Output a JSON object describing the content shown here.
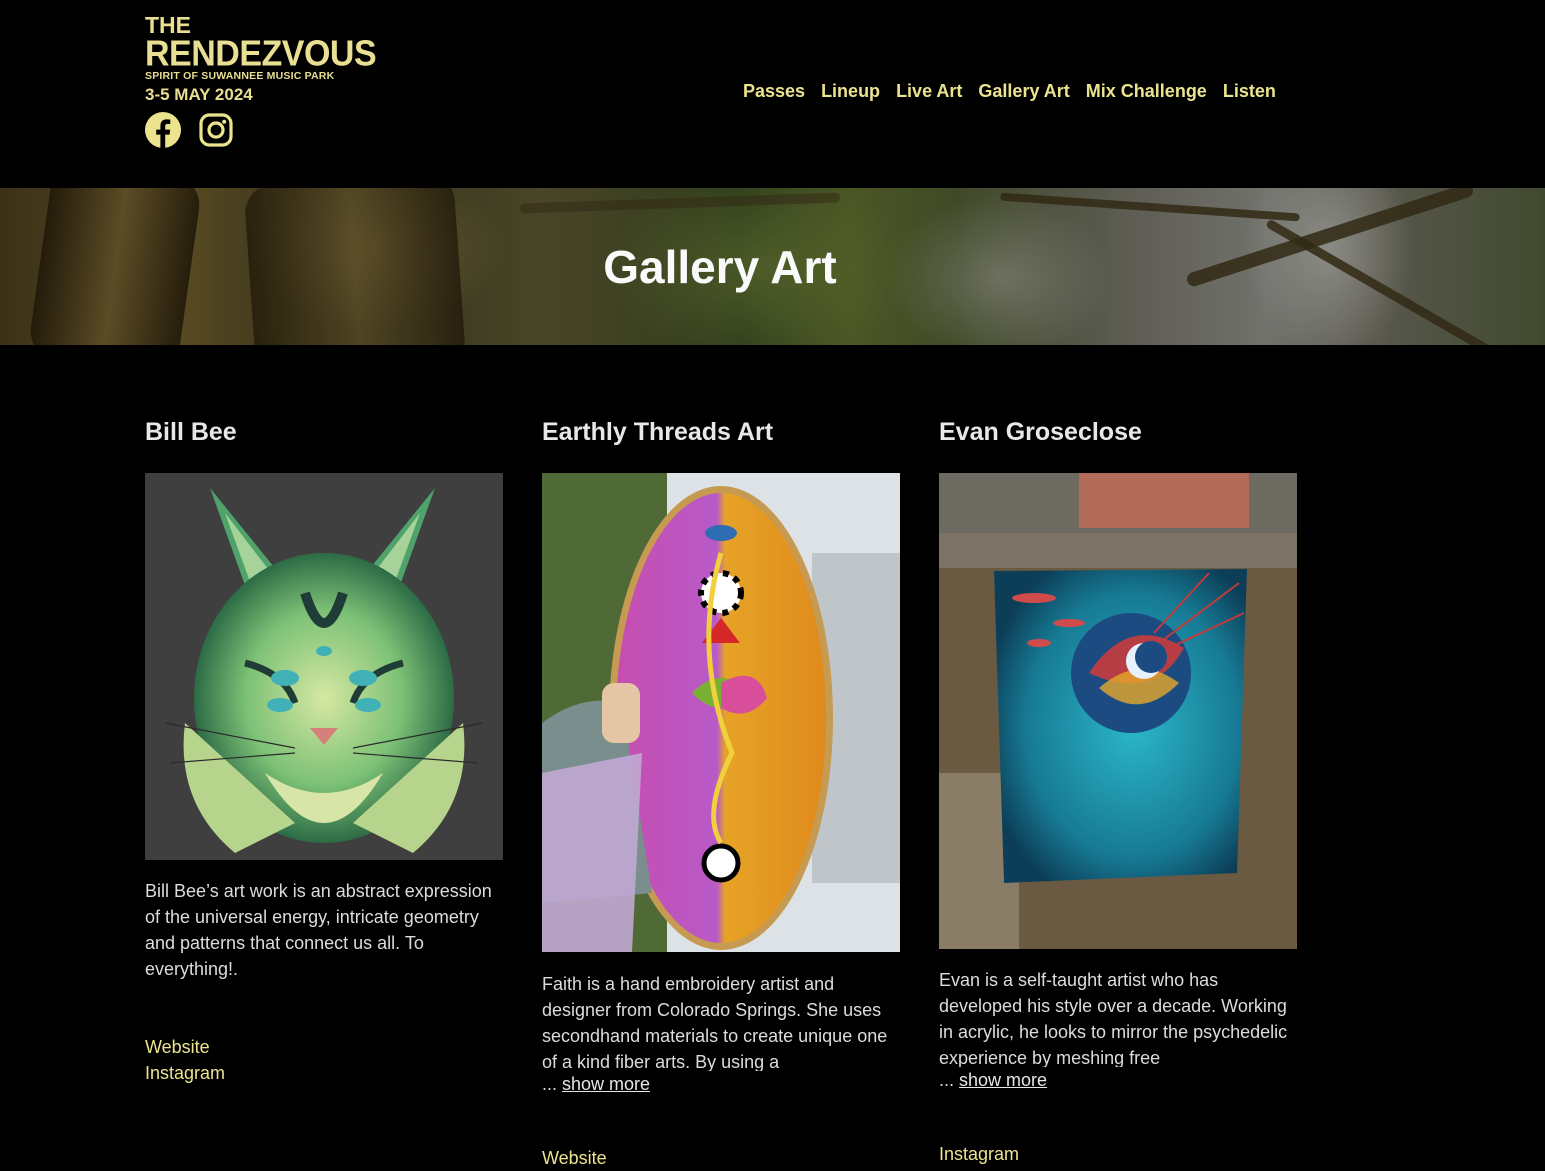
{
  "header": {
    "logo": {
      "line1": "THE",
      "line2": "RENDEZVOUS",
      "line3": "SPIRIT OF SUWANNEE MUSIC PARK",
      "line4": "3-5 MAY 2024"
    },
    "social": [
      {
        "icon": "facebook-icon"
      },
      {
        "icon": "instagram-icon"
      }
    ],
    "nav": [
      "Passes",
      "Lineup",
      "Live Art",
      "Gallery Art",
      "Mix Challenge",
      "Listen"
    ]
  },
  "hero": {
    "title": "Gallery Art"
  },
  "artists": [
    {
      "name": "Bill Bee",
      "description": "Bill Bee’s art work is an abstract expression of the universal energy, intricate geometry and patterns that connect us all. To everything!.",
      "links": [
        "Website",
        "Instagram"
      ]
    },
    {
      "name": "Earthly Threads Art",
      "description": "Faith is a hand embroidery artist and designer from Colorado Springs. She uses secondhand materials to create unique one of a kind fiber arts. By using a",
      "ellipsis": "... ",
      "show_more": "show more",
      "links": [
        "Website"
      ]
    },
    {
      "name": "Evan Groseclose",
      "description": "Evan is a self-taught artist who has developed his style over a decade. Working in acrylic, he looks to mirror the psychedelic experience by meshing free",
      "ellipsis": "... ",
      "show_more": "show more",
      "links": [
        "Instagram"
      ]
    }
  ],
  "colors": {
    "accent": "#ece38f",
    "background": "#000000",
    "text": "#e6e6e6"
  }
}
